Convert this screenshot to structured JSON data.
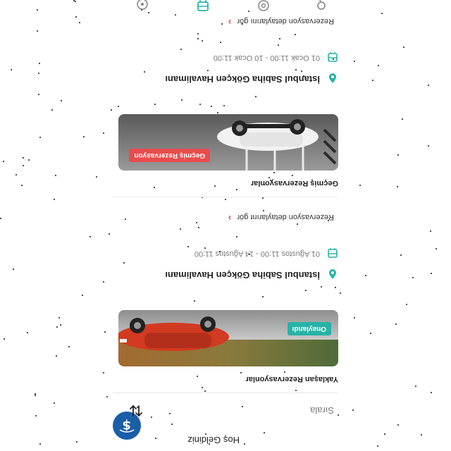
{
  "header": {
    "title": "Hoş Geldiniz",
    "logo_icon": "wallet-dollar-icon"
  },
  "sort": {
    "label": "Sırala",
    "icon": "sort-arrows-icon"
  },
  "upcoming": {
    "section_title": "Yaklaşan Rezervasyonlar",
    "card": {
      "status_badge": "Onaylandı",
      "status_color": "#26b3a6",
      "location": "İstanbul Sabiha Gökçen Havalimanı",
      "dates": "01 Ağustos 11:00 - 14 Ağustos 11:00",
      "details_link": "Rezervasyon detaylarını gör"
    }
  },
  "past": {
    "section_title": "Geçmiş Rezervasyonlar",
    "card": {
      "status_badge": "Geçmiş Rezervasyon",
      "status_color": "#e84c4c",
      "location": "İstanbul Sabiha Gökçen Havalimanı",
      "dates": "01 Ocak 11:00 - 10 Ocak 11:00",
      "details_link": "Rezervasyon detaylarını gör"
    }
  },
  "bottom_nav": {
    "items": [
      "location-pin-icon",
      "settings-gear-icon",
      "bus-icon",
      "steering-wheel-icon"
    ],
    "active_color": "#26b3a6"
  },
  "colors": {
    "brand": "#1a5ea8",
    "accent": "#26b3a6",
    "link_chevron": "#e84c4c"
  }
}
